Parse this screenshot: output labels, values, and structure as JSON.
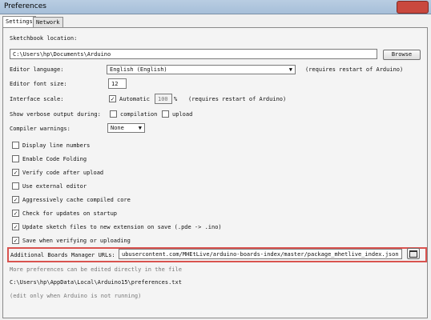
{
  "window": {
    "title": "Preferences"
  },
  "tabs": [
    {
      "label": "Settings"
    },
    {
      "label": "Network"
    }
  ],
  "sketchbook": {
    "label": "Sketchbook location:",
    "value": "C:\\Users\\hp\\Documents\\Arduino",
    "browse_label": "Browse"
  },
  "editor_language": {
    "label": "Editor language:",
    "value": "English (English)",
    "note": "(requires restart of Arduino)"
  },
  "editor_font_size": {
    "label": "Editor font size:",
    "value": "12"
  },
  "interface_scale": {
    "label": "Interface scale:",
    "automatic_label": "Automatic",
    "automatic_checked": true,
    "value": "100",
    "unit": "%",
    "note": "(requires restart of Arduino)"
  },
  "verbose": {
    "label": "Show verbose output during:",
    "compilation_label": "compilation",
    "upload_label": "upload"
  },
  "compiler_warnings": {
    "label": "Compiler warnings:",
    "value": "None"
  },
  "options": [
    {
      "label": "Display line numbers",
      "checked": false
    },
    {
      "label": "Enable Code Folding",
      "checked": false
    },
    {
      "label": "Verify code after upload",
      "checked": true
    },
    {
      "label": "Use external editor",
      "checked": false
    },
    {
      "label": "Aggressively cache compiled core",
      "checked": true
    },
    {
      "label": "Check for updates on startup",
      "checked": true
    },
    {
      "label": "Update sketch files to new extension on save (.pde -> .ino)",
      "checked": true
    },
    {
      "label": "Save when verifying or uploading",
      "checked": true
    }
  ],
  "boards_manager": {
    "label": "Additional Boards Manager URLs:",
    "value": "ubusercontent.com/MHEtLive/arduino-boards-index/master/package_mhetlive_index.json"
  },
  "footer": {
    "more_prefs": "More preferences can be edited directly in the file",
    "path": "C:\\Users\\hp\\AppData\\Local\\Arduino15\\preferences.txt",
    "edit_note": "(edit only when Arduino is not running)"
  }
}
